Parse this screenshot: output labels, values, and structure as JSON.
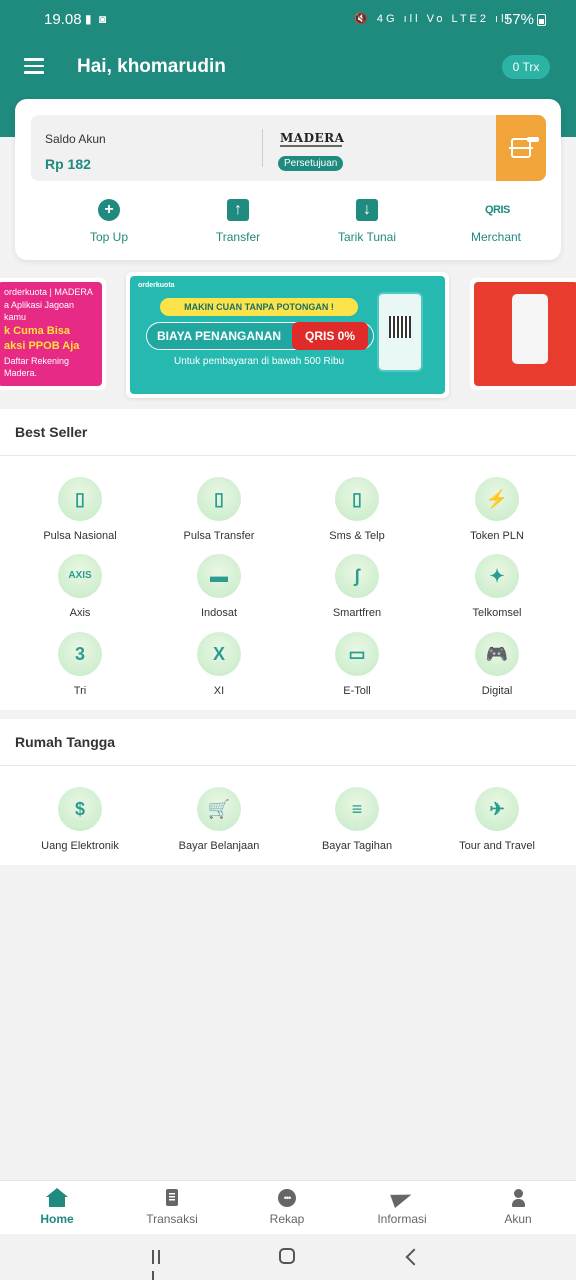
{
  "status_bar": {
    "time": "19.08",
    "left_icons": "▮ ◙",
    "right_icons": "🔇 4G ıll Vo LTE2 ıll",
    "battery": "57%"
  },
  "header": {
    "greeting": "Hai, khomarudin",
    "trx_count": "0 Trx"
  },
  "wallet": {
    "saldo_label": "Saldo Akun",
    "saldo_value": "Rp 182",
    "partner_logo": "MADERA",
    "partner_status": "Persetujuan",
    "actions": [
      {
        "label": "Top Up",
        "icon": "plus-circle-icon",
        "glyph": "+"
      },
      {
        "label": "Transfer",
        "icon": "arrow-up-icon",
        "glyph": "↑"
      },
      {
        "label": "Tarik Tunai",
        "icon": "arrow-down-icon",
        "glyph": "↓"
      },
      {
        "label": "Merchant",
        "icon": "qris-icon",
        "glyph": "QRIS"
      }
    ]
  },
  "banners": {
    "left": {
      "brand": "orderkuota | MADERA",
      "line1": "a Aplikasi Jagoan kamu",
      "line2": "k Cuma Bisa",
      "line3": "aksi PPOB Aja",
      "line4": "Daftar Rekening Madera."
    },
    "center": {
      "brand": "orderkuota",
      "headline": "MAKIN CUAN TANPA POTONGAN !",
      "main": "BIAYA PENANGANAN",
      "badge": "QRIS 0%",
      "sub": "Untuk pembayaran di bawah 500 Ribu"
    }
  },
  "best_seller": {
    "title": "Best Seller",
    "items": [
      {
        "label": "Pulsa Nasional",
        "icon": "phone-icon",
        "glyph": "▯"
      },
      {
        "label": "Pulsa Transfer",
        "icon": "phone-transfer-icon",
        "glyph": "▯"
      },
      {
        "label": "Sms & Telp",
        "icon": "phone-call-icon",
        "glyph": "▯"
      },
      {
        "label": "Token PLN",
        "icon": "lightning-icon",
        "glyph": "⚡"
      },
      {
        "label": "Axis",
        "icon": "axis-logo-icon",
        "glyph": "AXIS"
      },
      {
        "label": "Indosat",
        "icon": "indosat-logo-icon",
        "glyph": "▬"
      },
      {
        "label": "Smartfren",
        "icon": "smartfren-logo-icon",
        "glyph": "ʃ"
      },
      {
        "label": "Telkomsel",
        "icon": "telkomsel-logo-icon",
        "glyph": "✦"
      },
      {
        "label": "Tri",
        "icon": "tri-logo-icon",
        "glyph": "3"
      },
      {
        "label": "XI",
        "icon": "xl-logo-icon",
        "glyph": "X"
      },
      {
        "label": "E-Toll",
        "icon": "card-icon",
        "glyph": "▭"
      },
      {
        "label": "Digital",
        "icon": "gamepad-icon",
        "glyph": "🎮"
      }
    ]
  },
  "rumah_tangga": {
    "title": "Rumah Tangga",
    "items": [
      {
        "label": "Uang Elektronik",
        "icon": "money-icon",
        "glyph": "$"
      },
      {
        "label": "Bayar Belanjaan",
        "icon": "shopping-cart-icon",
        "glyph": "🛒"
      },
      {
        "label": "Bayar Tagihan",
        "icon": "bill-icon",
        "glyph": "≡"
      },
      {
        "label": "Tour and Travel",
        "icon": "globe-plane-icon",
        "glyph": "✈"
      }
    ]
  },
  "bottom_nav": [
    {
      "label": "Home",
      "icon": "home-icon",
      "active": true
    },
    {
      "label": "Transaksi",
      "icon": "document-icon",
      "active": false
    },
    {
      "label": "Rekap",
      "icon": "more-dots-icon",
      "active": false
    },
    {
      "label": "Informasi",
      "icon": "send-icon",
      "active": false
    },
    {
      "label": "Akun",
      "icon": "user-icon",
      "active": false
    }
  ],
  "colors": {
    "primary": "#1f8a7e",
    "accent_orange": "#f0a43a",
    "pill": "#2bb3a5"
  }
}
